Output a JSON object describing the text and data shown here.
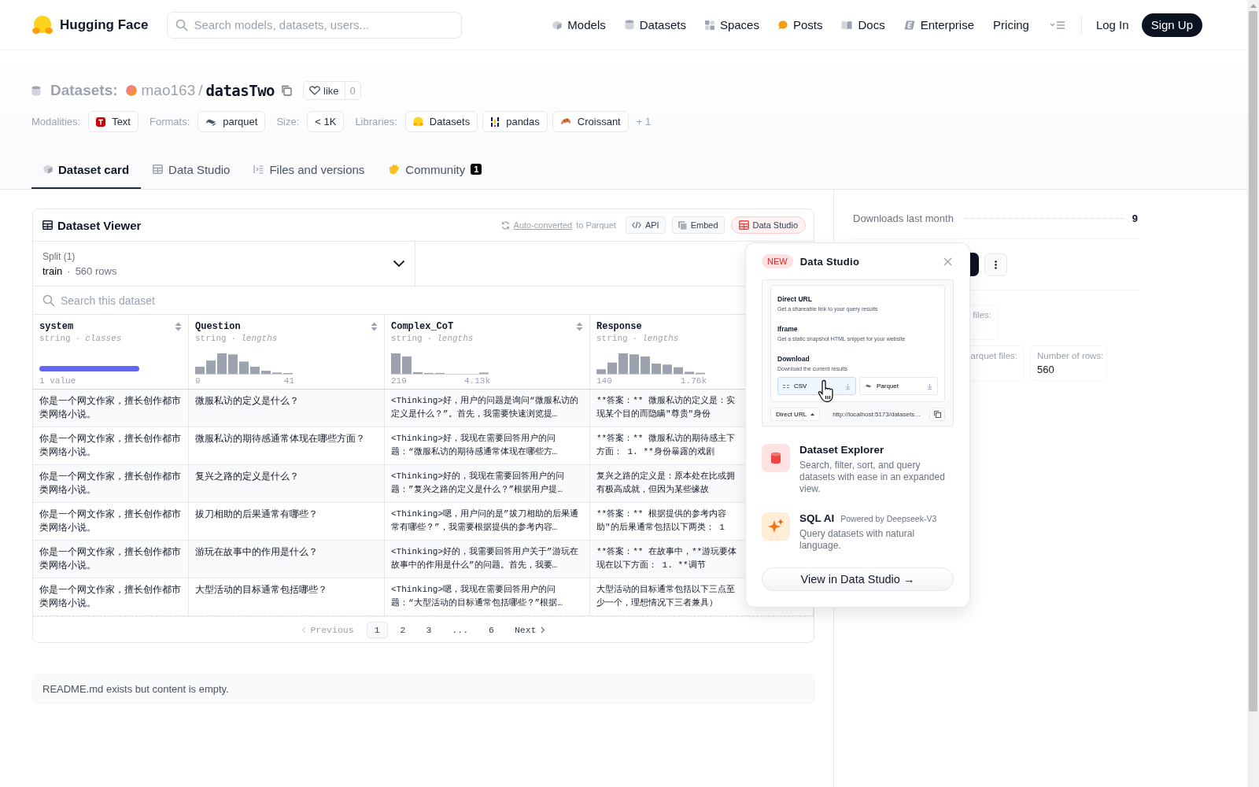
{
  "header": {
    "logo": "Hugging Face",
    "search": {
      "placeholder": "Search models, datasets, users..."
    },
    "nav": [
      {
        "label": "Models",
        "kind": "models"
      },
      {
        "label": "Datasets",
        "kind": "datasets"
      },
      {
        "label": "Spaces",
        "kind": "spaces"
      },
      {
        "label": "Posts",
        "kind": "posts"
      },
      {
        "label": "Docs",
        "kind": "docs"
      },
      {
        "label": "Enterprise",
        "kind": "enterprise"
      },
      {
        "label": "Pricing",
        "kind": "plain"
      }
    ],
    "login": "Log In",
    "signup": "Sign Up"
  },
  "repo": {
    "type_label": "Datasets:",
    "owner": "mao163",
    "separator": "/",
    "name": "datasTwo",
    "like": "like",
    "likes": "0"
  },
  "tag_groups": [
    {
      "label": "Modalities:",
      "items": [
        {
          "text": "Text",
          "kind": "text"
        }
      ]
    },
    {
      "label": "Formats:",
      "items": [
        {
          "text": "parquet",
          "kind": "parquet"
        }
      ]
    },
    {
      "label": "Size:",
      "items": [
        {
          "text": "< 1K",
          "kind": "plain"
        }
      ]
    },
    {
      "label": "Libraries:",
      "items": [
        {
          "text": "Datasets",
          "kind": "hf"
        },
        {
          "text": "pandas",
          "kind": "pandas"
        },
        {
          "text": "Croissant",
          "kind": "croissant"
        }
      ],
      "more": "+ 1"
    }
  ],
  "tabs": [
    {
      "label": "Dataset card",
      "kind": "card",
      "selected": true
    },
    {
      "label": "Data Studio",
      "kind": "table",
      "selected": false
    },
    {
      "label": "Files and versions",
      "kind": "files",
      "selected": false
    },
    {
      "label": "Community",
      "kind": "community",
      "selected": false,
      "badge": "1"
    }
  ],
  "viewer": {
    "title": "Dataset Viewer",
    "converted_link": "Auto-converted",
    "converted_text": "to Parquet",
    "buttons": [
      {
        "label": "API",
        "kind": "api",
        "active": false
      },
      {
        "label": "Embed",
        "kind": "embed",
        "active": false
      },
      {
        "label": "Data Studio",
        "kind": "studio",
        "active": true
      }
    ],
    "split": {
      "label": "Split (1)",
      "name": "train",
      "separator": "·",
      "rows": "560 rows"
    },
    "search": {
      "placeholder": "Search this dataset"
    },
    "columns": [
      {
        "name": "system",
        "type": "string",
        "separator": "·",
        "stat": "classes",
        "kind": "classes",
        "min": "1 value"
      },
      {
        "name": "Question",
        "type": "string",
        "separator": "·",
        "stat": "lengths",
        "kind": "lengths",
        "min": "9",
        "max": "41"
      },
      {
        "name": "Complex_CoT",
        "type": "string",
        "separator": "·",
        "stat": "lengths",
        "kind": "lengths",
        "min": "219",
        "max": "4.13k"
      },
      {
        "name": "Response",
        "type": "string",
        "separator": "·",
        "stat": "lengths",
        "kind": "lengths",
        "min": "140",
        "max": "1.76k"
      }
    ],
    "rows": [
      [
        "你是一个网文作家，擅长创作都市类网络小说。",
        "微服私访的定义是什么？",
        "<Thinking>好，用户的问题是询问“微服私访的定义是什么？”。首先，我需要快速浏览提…",
        "**答案：** 微服私访的定义是：实现某个目的而隐瞒\"尊贵\"身份"
      ],
      [
        "你是一个网文作家，擅长创作都市类网络小说。",
        "微服私访的期待感通常体现在哪些方面？",
        "<Thinking>好，我现在需要回答用户的问题：“微服私访的期待感通常体现在哪些方…",
        "**答案：** 微服私访的期待感主下方面： 1. **身份暴露的戏剧"
      ],
      [
        "你是一个网文作家，擅长创作都市类网络小说。",
        "复兴之路的定义是什么？",
        "<Thinking>好的，我现在需要回答用户的问题：”复兴之路的定义是什么？”根据用户提…",
        "复兴之路的定义是：原本处在比或拥有极高成就，但因为某些缘故"
      ],
      [
        "你是一个网文作家，擅长创作都市类网络小说。",
        "拔刀相助的后果通常有哪些？",
        "<Thinking>嗯，用户问的是”拔刀相助的后果通常有哪些？”，我需要根据提供的参考内容…",
        "**答案：** 根据提供的参考内容助\"的后果通常包括以下两类： 1"
      ],
      [
        "你是一个网文作家，擅长创作都市类网络小说。",
        "游玩在故事中的作用是什么？",
        "<Thinking>好的，我需要回答用户关于”游玩在故事中的作用是什么”的问题。首先，我要…",
        "**答案：** 在故事中，**游玩要体现在以下方面： 1. **调节"
      ],
      [
        "你是一个网文作家，擅长创作都市类网络小说。",
        "大型活动的目标通常包括哪些？",
        "<Thinking>嗯，我现在需要回答用户的问题：“大型活动的目标通常包括哪些？”根据…",
        "大型活动的目标通常包括以下三点至少一个，理想情况下三者兼具）"
      ]
    ],
    "pagination": [
      {
        "label": "Previous",
        "kind": "prev",
        "disabled": true,
        "selected": false
      },
      {
        "label": "1",
        "kind": "page",
        "disabled": false,
        "selected": true
      },
      {
        "label": "2",
        "kind": "page",
        "disabled": false,
        "selected": false
      },
      {
        "label": "3",
        "kind": "page",
        "disabled": false,
        "selected": false
      },
      {
        "label": "...",
        "kind": "gap",
        "disabled": false,
        "selected": false
      },
      {
        "label": "6",
        "kind": "page",
        "disabled": false,
        "selected": false
      },
      {
        "label": "Next",
        "kind": "next",
        "disabled": false,
        "selected": false
      }
    ]
  },
  "readme": "README.md exists but content is empty.",
  "sidebar": {
    "downloads_label": "Downloads last month",
    "downloads": "9",
    "cards": [
      {
        "label": "files:"
      },
      {
        "label": "arquet files:"
      },
      {
        "label": "Number of rows:",
        "value": "560"
      }
    ]
  },
  "popup": {
    "badge": "NEW",
    "title": "Data Studio",
    "preview": {
      "sections": [
        {
          "title": "Direct URL",
          "text": "Get a shareable link to your query results"
        },
        {
          "title": "Iframe",
          "text": "Get a static snapshot HTML snippet for your website"
        },
        {
          "title": "Download",
          "text": "Download the current results"
        }
      ],
      "formats": [
        {
          "label": "CSV",
          "selected": true
        },
        {
          "label": "Parquet",
          "selected": false
        }
      ],
      "share_mode": "Direct URL",
      "url": "http://localhost:5173/datasets…"
    },
    "features": [
      {
        "kind": "explorer",
        "title": "Dataset Explorer",
        "text": "Search, filter, sort, and query datasets with ease in an expanded view."
      },
      {
        "kind": "sql",
        "title": "SQL AI",
        "note": "Powered by Deepseek-V3",
        "text": "Query datasets with natural language."
      }
    ],
    "button": "View in Data Studio →"
  }
}
